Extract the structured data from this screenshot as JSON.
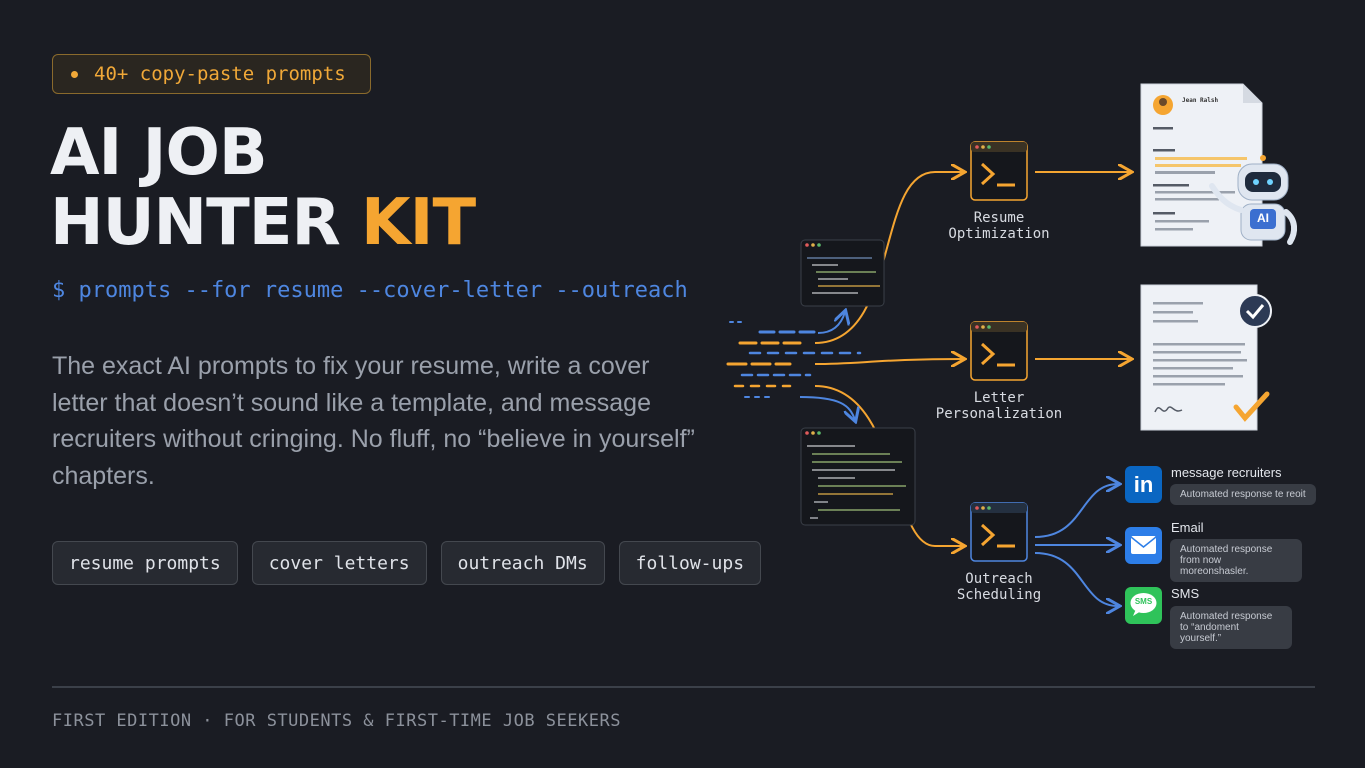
{
  "badge": {
    "label": "40+ copy-paste prompts"
  },
  "title": {
    "line1": "AI JOB",
    "line2_main": "HUNTER",
    "line2_accent": "KIT"
  },
  "command": "$ prompts --for resume --cover-letter --outreach",
  "description": "The exact AI prompts to fix your resume, write a cover letter that doesn’t sound like a template, and message recruiters without cringing. No fluff, no “believe in yourself” chapters.",
  "tags": [
    "resume prompts",
    "cover letters",
    "outreach DMs",
    "follow-ups"
  ],
  "footer": "FIRST EDITION · FOR STUDENTS & FIRST-TIME JOB SEEKERS",
  "diagram": {
    "nodes": [
      {
        "line1": "Resume",
        "line2": "Optimization"
      },
      {
        "line1": "Letter",
        "line2": "Personalization"
      },
      {
        "line1": "Outreach",
        "line2": "Scheduling"
      }
    ],
    "resume_doc": {
      "name": "Jean Ralsh"
    },
    "robot_label": "AI",
    "channels": [
      {
        "title": "message recruiters",
        "reply": "Automated response te reoit",
        "icon": "linkedin-icon",
        "icon_text": "in"
      },
      {
        "title": "Email",
        "reply": "Automated response from now moreonshasler.",
        "icon": "email-icon"
      },
      {
        "title": "SMS",
        "reply": "Automated response to “andoment yourself.”",
        "icon": "sms-icon",
        "icon_text": "SMS"
      }
    ]
  },
  "colors": {
    "accent": "#f5a531",
    "blue": "#4e86e0",
    "background": "#1a1c23"
  }
}
